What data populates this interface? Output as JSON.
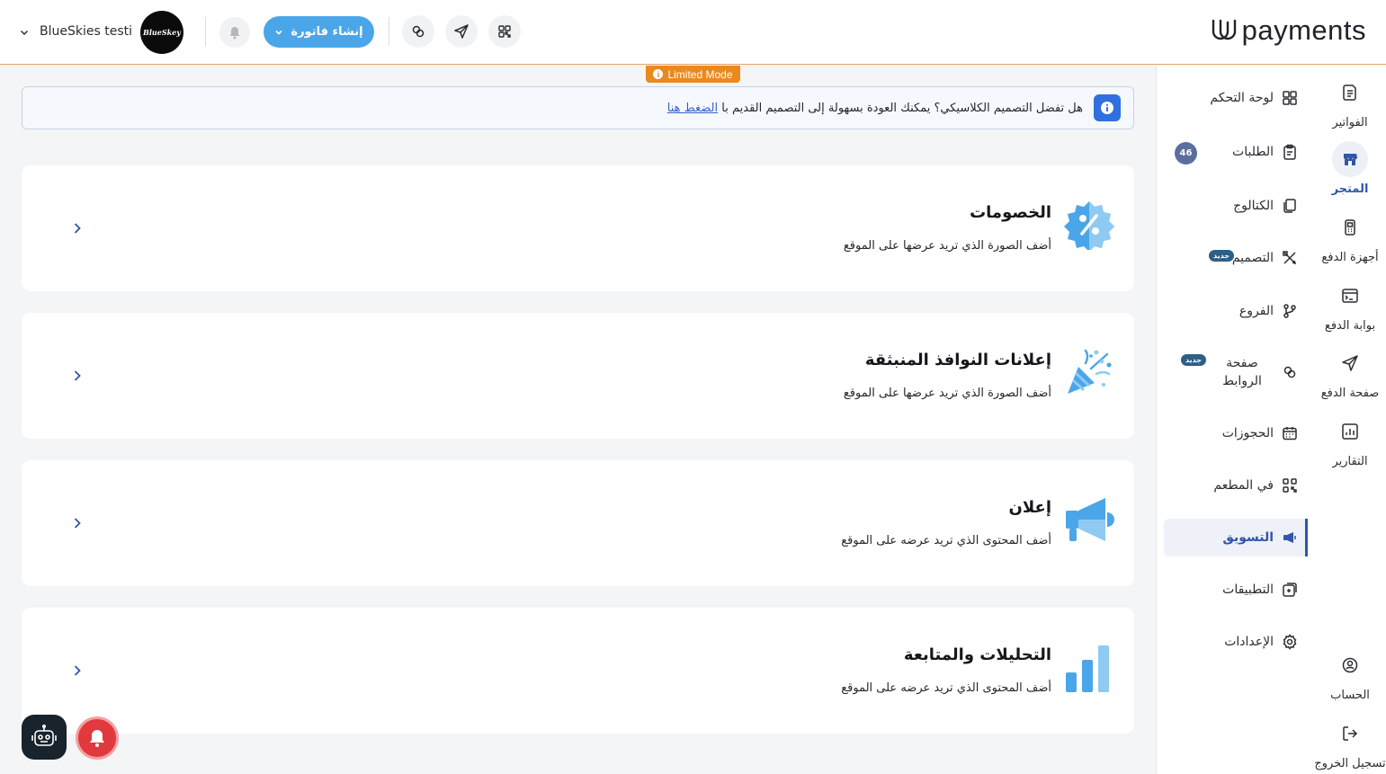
{
  "header": {
    "logo_text": "payments",
    "create_invoice_label": "إنشاء فاتورة",
    "account_name": "BlueSkies testi…",
    "avatar_text": "BlueSkey",
    "icons": [
      "qr-icon",
      "send-icon",
      "link-icon",
      "bell-icon",
      "chevron-down-icon"
    ]
  },
  "limited_mode": {
    "label": "Limited Mode"
  },
  "banner": {
    "text": "هل تفضل التصميم الكلاسيكي؟ يمكنك العودة بسهولة إلى التصميم القديم با",
    "link_text": "الضغط هنا"
  },
  "cards": [
    {
      "title": "الخصومات",
      "subtitle": "أضف الصورة الذي تريد عرضها على الموقع",
      "icon": "discount-badge-icon"
    },
    {
      "title": "إعلانات النوافذ المنبثقة",
      "subtitle": "أضف الصورة الذي تريد عرضها على الموقع",
      "icon": "party-popper-icon"
    },
    {
      "title": "إعلان",
      "subtitle": "أضف المحتوى الذي تريد عرضه على الموقع",
      "icon": "megaphone-icon"
    },
    {
      "title": "التحليلات والمتابعة",
      "subtitle": "أضف المحتوى الذي تريد عرضه على الموقع",
      "icon": "bar-chart-icon"
    }
  ],
  "nav": {
    "items": [
      {
        "label": "لوحة التحكم",
        "icon": "grid-icon"
      },
      {
        "label": "الطلبات",
        "icon": "clipboard-icon",
        "count": "46"
      },
      {
        "label": "الكتالوج",
        "icon": "catalog-icon"
      },
      {
        "label": "التصميم",
        "icon": "design-tools-icon",
        "badge": "جديد"
      },
      {
        "label": "الفروع",
        "icon": "branch-icon"
      },
      {
        "label": "صفحة الروابط",
        "icon": "link-icon",
        "badge": "جديد"
      },
      {
        "label": "الحجوزات",
        "icon": "calendar-icon"
      },
      {
        "label": "في المطعم",
        "icon": "qr-icon"
      },
      {
        "label": "التسويق",
        "icon": "megaphone-icon",
        "active": true
      },
      {
        "label": "التطبيقات",
        "icon": "apps-icon"
      },
      {
        "label": "الإعدادات",
        "icon": "gear-icon"
      }
    ]
  },
  "rail": {
    "items": [
      {
        "label": "الفواتير",
        "icon": "invoice-icon"
      },
      {
        "label": "المتجر",
        "icon": "store-icon",
        "active": true
      },
      {
        "label": "أجهزة الدفع",
        "icon": "pos-device-icon"
      },
      {
        "label": "بوابة الدفع",
        "icon": "terminal-icon"
      },
      {
        "label": "صفحة الدفع",
        "icon": "send-icon"
      },
      {
        "label": "التقارير",
        "icon": "report-icon"
      }
    ],
    "bottom": [
      {
        "label": "الحساب",
        "icon": "account-icon"
      },
      {
        "label": "تسجيل الخروج",
        "icon": "logout-icon"
      }
    ]
  },
  "colors": {
    "accent": "#2f56a8",
    "primary_button": "#4aa6e8",
    "limited_mode": "#e98a1f",
    "illustration": "#4aa6e8",
    "notification": "#e0393e"
  }
}
